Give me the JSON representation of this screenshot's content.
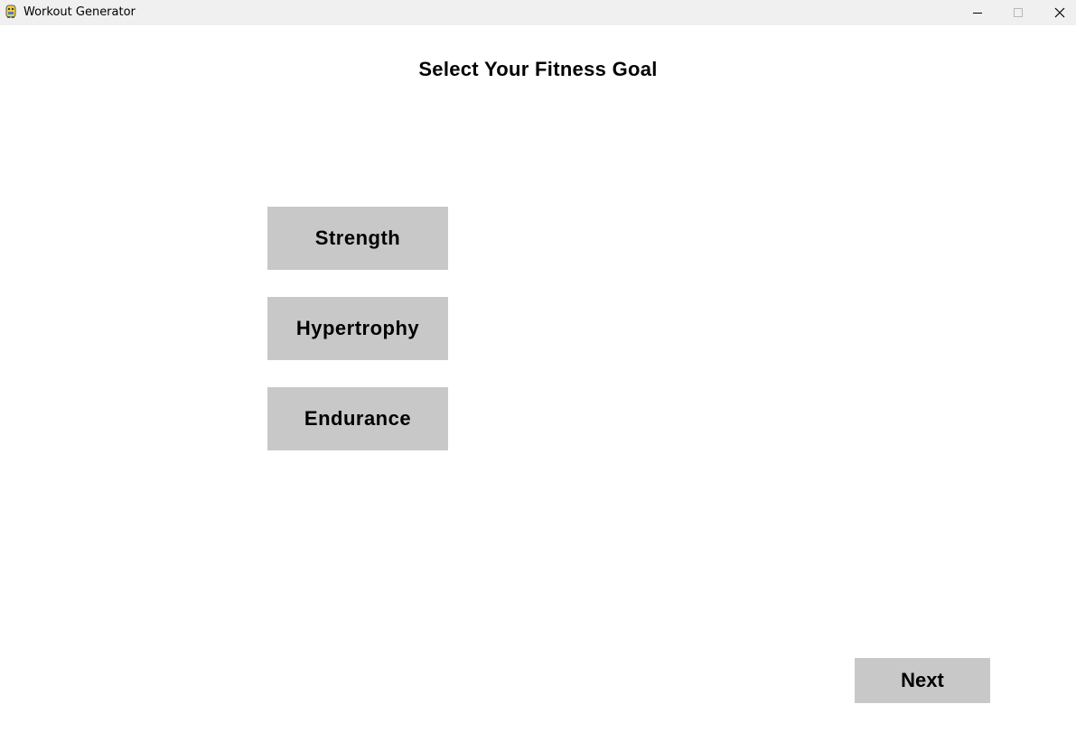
{
  "window": {
    "title": "Workout Generator",
    "app_icon": "pygame-snake-icon",
    "controls": {
      "minimize_icon": "minimize-icon",
      "maximize_icon": "maximize-icon",
      "close_icon": "close-icon"
    }
  },
  "main": {
    "heading": "Select Your Fitness Goal",
    "goals": [
      {
        "label": "Strength"
      },
      {
        "label": "Hypertrophy"
      },
      {
        "label": "Endurance"
      }
    ],
    "next_label": "Next"
  },
  "colors": {
    "button_bg": "#c8c8c8",
    "titlebar_bg": "#f0f0f0",
    "background": "#ffffff",
    "text": "#000000"
  }
}
